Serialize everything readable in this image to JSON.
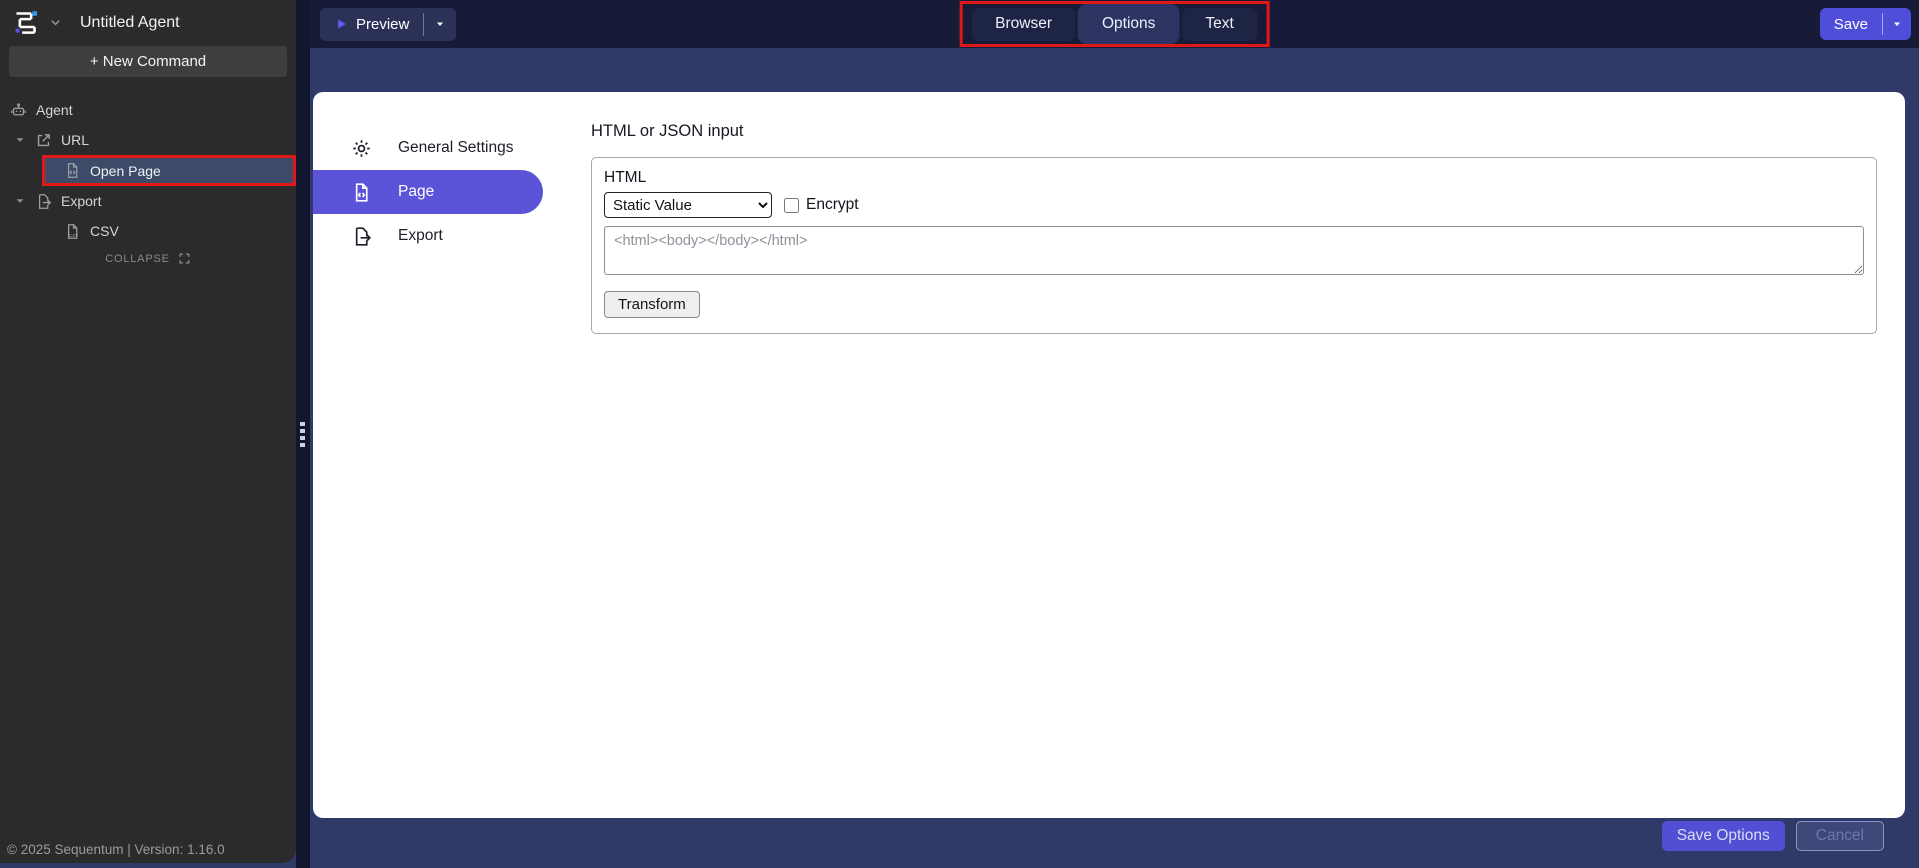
{
  "app": {
    "title": "Untitled Agent"
  },
  "sidebar": {
    "new_command_label": "+ New Command",
    "tree": [
      {
        "label": "Agent",
        "icon": "robot-icon",
        "depth": 0,
        "expandable": false,
        "selected": false
      },
      {
        "label": "URL",
        "icon": "external-link-icon",
        "depth": 1,
        "expandable": true,
        "selected": false
      },
      {
        "label": "Open Page",
        "icon": "file-code-icon",
        "depth": 2,
        "expandable": false,
        "selected": true,
        "annotated": true
      },
      {
        "label": "Export",
        "icon": "file-export-icon",
        "depth": 1,
        "expandable": true,
        "selected": false
      },
      {
        "label": "CSV",
        "icon": "file-csv-icon",
        "depth": 2,
        "expandable": false,
        "selected": false
      }
    ],
    "collapse_label": "COLLAPSE",
    "collapse_icon": "expand-icon",
    "footer_text": "© 2025 Sequentum | Version: 1.16.0"
  },
  "topbar": {
    "preview_label": "Preview",
    "preview_icon": "play-icon",
    "tabs": [
      {
        "label": "Browser",
        "active": false
      },
      {
        "label": "Options",
        "active": true
      },
      {
        "label": "Text",
        "active": false
      }
    ],
    "save_label": "Save"
  },
  "options_panel": {
    "nav": [
      {
        "label": "General Settings",
        "icon": "gear-icon",
        "active": false
      },
      {
        "label": "Page",
        "icon": "file-code-icon",
        "active": true
      },
      {
        "label": "Export",
        "icon": "file-export-icon",
        "active": false
      }
    ],
    "heading": "HTML or JSON input",
    "form": {
      "field_label": "HTML",
      "value_type_selected": "Static Value",
      "encrypt_label": "Encrypt",
      "encrypt_checked": false,
      "input_value": "",
      "input_placeholder": "<html><body></body></html>",
      "transform_label": "Transform"
    },
    "footer_actions": {
      "save_options_label": "Save Options",
      "cancel_label": "Cancel"
    }
  },
  "colors": {
    "accent_indigo": "#5453d9",
    "annotation_red": "#e01818",
    "topbar_navy": "#171b38",
    "content_navy": "#2f3a68",
    "sidebar_dark": "#2b2b2b",
    "selected_row": "#3d4a68"
  }
}
